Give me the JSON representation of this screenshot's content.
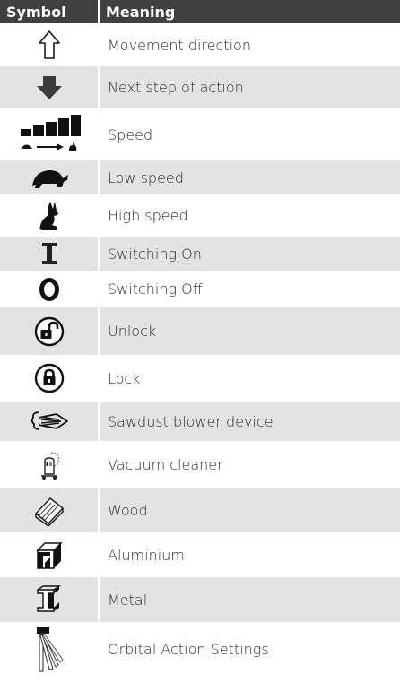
{
  "header": {
    "symbol": "Symbol",
    "meaning": "Meaning"
  },
  "rows": [
    {
      "icon": "outline-up-arrow-icon",
      "meaning": "Movement direction"
    },
    {
      "icon": "solid-down-arrow-icon",
      "meaning": "Next step of action"
    },
    {
      "icon": "speed-scale-icon",
      "meaning": "Speed"
    },
    {
      "icon": "turtle-icon",
      "meaning": "Low speed"
    },
    {
      "icon": "rabbit-icon",
      "meaning": "High speed"
    },
    {
      "icon": "switch-on-icon",
      "meaning": "Switching On"
    },
    {
      "icon": "switch-off-icon",
      "meaning": "Switching Off"
    },
    {
      "icon": "unlock-icon",
      "meaning": "Unlock"
    },
    {
      "icon": "lock-icon",
      "meaning": "Lock"
    },
    {
      "icon": "sawdust-blower-icon",
      "meaning": "Sawdust blower device"
    },
    {
      "icon": "vacuum-cleaner-icon",
      "meaning": "Vacuum cleaner"
    },
    {
      "icon": "wood-icon",
      "meaning": "Wood"
    },
    {
      "icon": "aluminium-icon",
      "meaning": "Aluminium"
    },
    {
      "icon": "metal-icon",
      "meaning": "Metal"
    },
    {
      "icon": "orbital-action-icon",
      "meaning": "Orbital Action Settings"
    }
  ],
  "colors": {
    "header_bg": "#404040",
    "row_alt_bg": "#e3e3e3",
    "text": "#2b2b2b"
  }
}
